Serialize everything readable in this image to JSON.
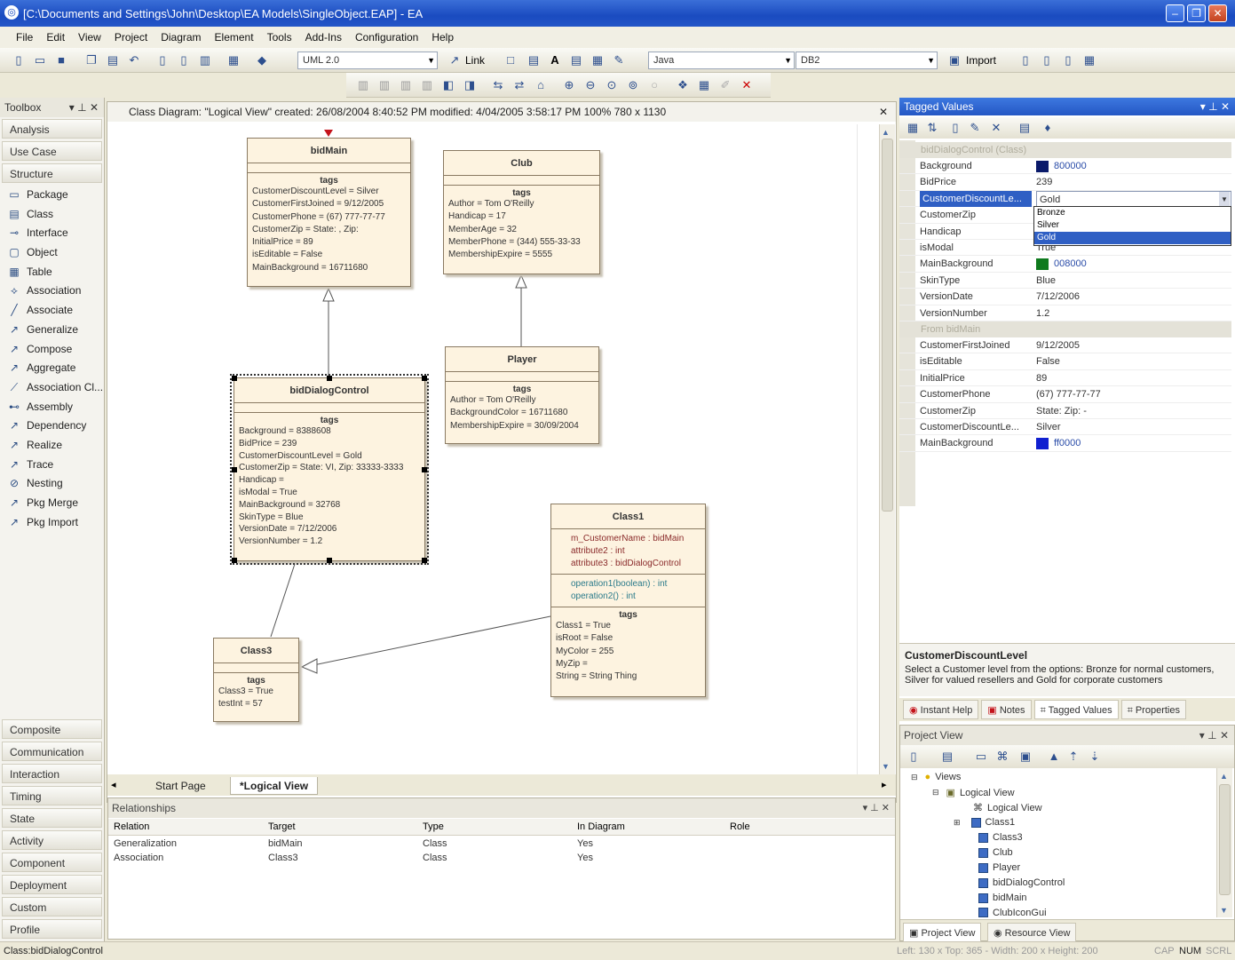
{
  "window": {
    "title": "[C:\\Documents and Settings\\John\\Desktop\\EA Models\\SingleObject.EAP] - EA",
    "app_icon": "ea-app-icon"
  },
  "menu": [
    "File",
    "Edit",
    "View",
    "Project",
    "Diagram",
    "Element",
    "Tools",
    "Add-Ins",
    "Configuration",
    "Help"
  ],
  "toolbar": {
    "uml_combo": "UML 2.0",
    "link_label": "Link",
    "language_combo": "Java",
    "db_combo": "DB2",
    "import_label": "Import"
  },
  "toolbox": {
    "title": "Toolbox",
    "top_categories": [
      "Analysis",
      "Use Case",
      "Structure"
    ],
    "items": [
      "Package",
      "Class",
      "Interface",
      "Object",
      "Table",
      "Association",
      "Associate",
      "Generalize",
      "Compose",
      "Aggregate",
      "Association Cl...",
      "Assembly",
      "Dependency",
      "Realize",
      "Trace",
      "Nesting",
      "Pkg Merge",
      "Pkg Import"
    ],
    "bottom_categories": [
      "Composite",
      "Communication",
      "Interaction",
      "Timing",
      "State",
      "Activity",
      "Component",
      "Deployment",
      "Custom",
      "Profile"
    ]
  },
  "diagram": {
    "header": "Class Diagram: \"Logical View\"   created: 26/08/2004 8:40:52 PM   modified: 4/04/2005 3:58:17 PM   100%   780 x 1130",
    "classes": {
      "bidMain": {
        "name": "bidMain",
        "tags_label": "tags",
        "lines": [
          "CustomerDiscountLevel = Silver",
          "CustomerFirstJoined = 9/12/2005",
          "CustomerPhone = (67) 777-77-77",
          "CustomerZip = State: , Zip:",
          "InitialPrice = 89",
          "isEditable = False",
          "MainBackground = 16711680"
        ]
      },
      "club": {
        "name": "Club",
        "tags_label": "tags",
        "lines": [
          "Author = Tom O'Reilly",
          "Handicap = 17",
          "MemberAge = 32",
          "MemberPhone = (344) 555-33-33",
          "MembershipExpire = 5555"
        ]
      },
      "player": {
        "name": "Player",
        "tags_label": "tags",
        "lines": [
          "Author = Tom O'Reilly",
          "BackgroundColor = 16711680",
          "MembershipExpire = 30/09/2004"
        ]
      },
      "bidDialogControl": {
        "name": "bidDialogControl",
        "tags_label": "tags",
        "lines": [
          "Background = 8388608",
          "BidPrice = 239",
          "CustomerDiscountLevel = Gold",
          "CustomerZip = State: VI, Zip: 33333-3333",
          "Handicap =",
          "isModal = True",
          "MainBackground = 32768",
          "SkinType = Blue",
          "VersionDate = 7/12/2006",
          "VersionNumber = 1.2"
        ]
      },
      "class1": {
        "name": "Class1",
        "attributes": [
          "m_CustomerName : bidMain",
          "attribute2 : int",
          "attribute3 : bidDialogControl"
        ],
        "operations": [
          "operation1(boolean) : int",
          "operation2() : int"
        ],
        "tags_label": "tags",
        "lines": [
          "Class1 = True",
          "isRoot = False",
          "MyColor = 255",
          "MyZip =",
          "String = String Thing"
        ]
      },
      "class3": {
        "name": "Class3",
        "tags_label": "tags",
        "lines": [
          "Class3 = True",
          "testInt = 57"
        ]
      }
    }
  },
  "doc_tabs": [
    "Start Page",
    "*Logical View"
  ],
  "relationships": {
    "title": "Relationships",
    "columns": [
      "Relation",
      "Target",
      "Type",
      "In Diagram",
      "Role"
    ],
    "rows": [
      [
        "Generalization",
        "bidMain",
        "Class",
        "Yes",
        ""
      ],
      [
        "Association",
        "Class3",
        "Class",
        "Yes",
        ""
      ]
    ]
  },
  "tagged_values": {
    "title": "Tagged Values",
    "group1": "bidDialogControl (Class)",
    "rows1": [
      {
        "key": "Background",
        "value": "800000",
        "swatch": "#0a1a6a"
      },
      {
        "key": "BidPrice",
        "value": "239"
      },
      {
        "key": "CustomerDiscountLe...",
        "value": "Gold",
        "selected": true
      },
      {
        "key": "CustomerZip",
        "value": ""
      },
      {
        "key": "Handicap",
        "value": ""
      },
      {
        "key": "isModal",
        "value": "True"
      },
      {
        "key": "MainBackground",
        "value": "008000",
        "swatch": "#0f7a1e"
      },
      {
        "key": "SkinType",
        "value": "Blue"
      },
      {
        "key": "VersionDate",
        "value": "7/12/2006"
      },
      {
        "key": "VersionNumber",
        "value": "1.2"
      }
    ],
    "group2": "From bidMain",
    "rows2": [
      {
        "key": "CustomerFirstJoined",
        "value": "9/12/2005"
      },
      {
        "key": "isEditable",
        "value": "False"
      },
      {
        "key": "InitialPrice",
        "value": "89"
      },
      {
        "key": "CustomerPhone",
        "value": "(67) 777-77-77"
      },
      {
        "key": "CustomerZip",
        "value": "State:   Zip:   -"
      },
      {
        "key": "CustomerDiscountLe...",
        "value": "Silver"
      },
      {
        "key": "MainBackground",
        "value": "ff0000",
        "swatch": "#1020d0"
      }
    ],
    "dropdown_options": [
      "Bronze",
      "Silver",
      "Gold"
    ],
    "dropdown_selected": "Gold"
  },
  "description": {
    "title": "CustomerDiscountLevel",
    "text": "Select a Customer level from the options: Bronze for normal customers, Silver for valued resellers and Gold for corporate customers"
  },
  "panel_tabs": [
    "Instant Help",
    "Notes",
    "Tagged Values",
    "Properties"
  ],
  "project_view": {
    "title": "Project View",
    "nodes": [
      "Views",
      "Logical View",
      "Logical View",
      "Class1",
      "Class3",
      "Club",
      "Player",
      "bidDialogControl",
      "bidMain",
      "ClubIconGui"
    ],
    "tabs": [
      "Project View",
      "Resource View"
    ]
  },
  "status": {
    "left": "Class:bidDialogControl",
    "right": "Left: 130 x Top: 365 - Width: 200 x Height: 200",
    "indicators": [
      "CAP",
      "NUM",
      "SCRL"
    ]
  }
}
